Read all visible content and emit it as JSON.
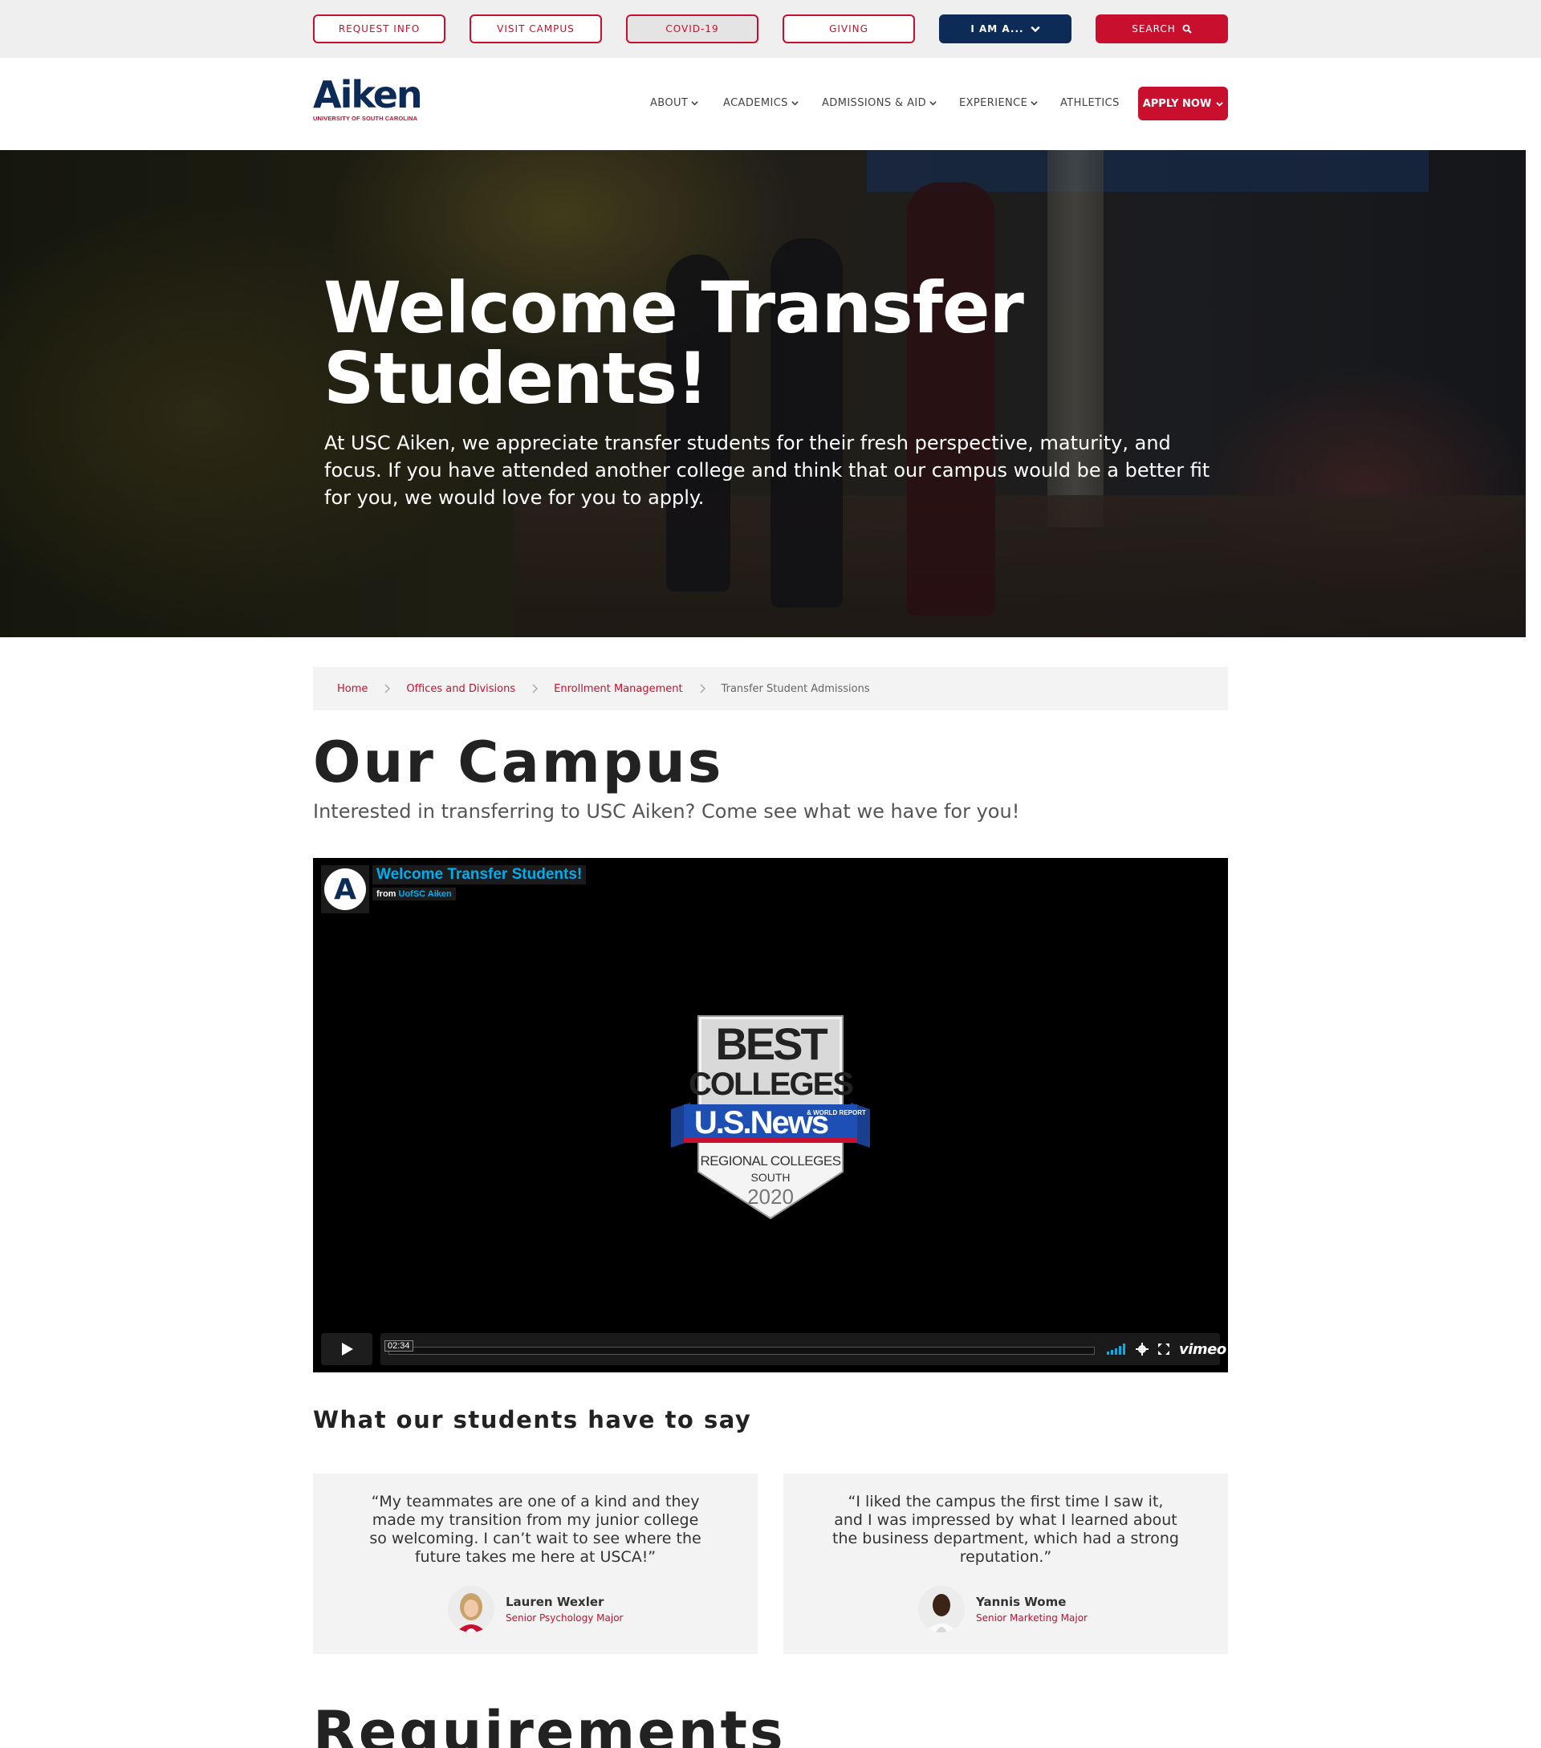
{
  "utility_bar": {
    "request_info": "REQUEST INFO",
    "visit_campus": "VISIT CAMPUS",
    "covid": "COVID-19",
    "giving": "GIVING",
    "i_am_a": "I AM A...",
    "search": "SEARCH"
  },
  "logo": {
    "word": "Aiken",
    "sub": "UNIVERSITY OF SOUTH CAROLINA"
  },
  "nav": {
    "about": "ABOUT",
    "academics": "ACADEMICS",
    "admissions": "ADMISSIONS & AID",
    "experience": "EXPERIENCE",
    "athletics": "ATHLETICS",
    "apply": "APPLY NOW"
  },
  "hero": {
    "title_line1": "Welcome Transfer",
    "title_line2": "Students!",
    "text": "At USC Aiken, we appreciate transfer students for their fresh perspective, maturity, and focus. If you have attended another college and think that our campus would be a better fit for you, we would love for you to apply."
  },
  "breadcrumb": [
    {
      "label": "Home"
    },
    {
      "label": "Offices and Divisions"
    },
    {
      "label": "Enrollment Management"
    },
    {
      "label": "Transfer Student Admissions"
    }
  ],
  "campus": {
    "title": "Our Campus",
    "intro": "Interested in transferring to USC Aiken? Come see what we have for you!"
  },
  "video": {
    "title": "Welcome Transfer Students!",
    "from_prefix": "from",
    "from_channel": "UofSC Aiken",
    "avatar_letter": "A",
    "time": "02:34",
    "brand": "vimeo",
    "badge": {
      "line1": "BEST",
      "line2": "COLLEGES",
      "ribbon": "U.S.News",
      "ribbon_small": "& WORLD REPORT",
      "line3": "REGIONAL COLLEGES",
      "line4": "SOUTH",
      "year": "2020"
    }
  },
  "testimonials": {
    "title": "What our students have to say",
    "items": [
      {
        "quote": "“My teammates are one of a kind and they made my transition from my junior college so welcoming. I can’t wait to see where the future takes me here at USCA!”",
        "name": "Lauren Wexler",
        "role": "Senior Psychology Major"
      },
      {
        "quote": "“I liked the campus the first time I saw it, and I was impressed by what I learned about the business department, which had a strong reputation.”",
        "name": "Yannis Wome",
        "role": "Senior Marketing Major"
      }
    ]
  },
  "requirements": {
    "title": "Requirements"
  },
  "colors": {
    "brand_red": "#c8102e",
    "brand_navy": "#0c2b57",
    "vimeo_blue": "#00adef"
  }
}
